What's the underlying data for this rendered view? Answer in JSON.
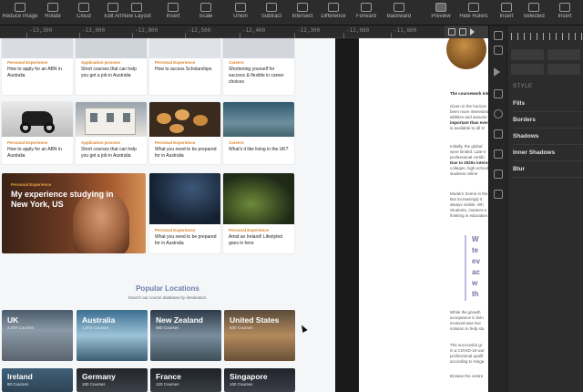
{
  "toolbar": {
    "items": [
      {
        "label": "Reduce Image",
        "icon": "image-icon"
      },
      {
        "label": "Rotate",
        "icon": "rotate-icon"
      },
      {
        "label": "Cloud",
        "icon": "cloud-icon"
      },
      {
        "label": "Edit Art",
        "icon": "pen-icon"
      },
      {
        "label": "New Layout",
        "icon": "layout-icon"
      },
      {
        "label": "Insert",
        "icon": "insert-icon"
      },
      {
        "label": "Scale",
        "icon": "scale-icon"
      },
      {
        "label": "Union",
        "icon": "union-icon"
      },
      {
        "label": "Subtract",
        "icon": "subtract-icon"
      },
      {
        "label": "Intersect",
        "icon": "intersect-icon"
      },
      {
        "label": "Difference",
        "icon": "difference-icon"
      },
      {
        "label": "Forward",
        "icon": "forward-icon"
      },
      {
        "label": "Backward",
        "icon": "backward-icon"
      },
      {
        "label": "Preview",
        "icon": "preview-icon"
      },
      {
        "label": "Hide Rulers",
        "icon": "ruler-icon"
      },
      {
        "label": "Insert",
        "icon": "insert-icon"
      },
      {
        "label": "Selected",
        "icon": "selected-icon"
      },
      {
        "label": "Insert",
        "icon": "insert-icon"
      }
    ]
  },
  "ruler": {
    "ticks": [
      "-13,300",
      "-13,000",
      "-12,800",
      "-12,500",
      "-12,400",
      "-12,300",
      "-12,080",
      "-11,800"
    ]
  },
  "cards_top": [
    {
      "category": "Personal Experience",
      "title": "How to apply for an ABN in Australia"
    },
    {
      "category": "Application process",
      "title": "Short courses that can help you get a job in Australia"
    },
    {
      "category": "Personal Experience",
      "title": "How to access Scholarships"
    },
    {
      "category": "Careers",
      "title": "Shortening yourself for success & flexible in career choices"
    }
  ],
  "cards_mid": [
    {
      "category": "Personal Experience",
      "title": "How to apply for an ABN in Australia"
    },
    {
      "category": "Application process",
      "title": "Short courses that can help you get a job in Australia"
    },
    {
      "category": "Personal Experience",
      "title": "What you need to be prepared for in Australia"
    },
    {
      "category": "Careers",
      "title": "What's it like living in the UK?"
    }
  ],
  "feature_card": {
    "category": "Personal Experience",
    "title": "My experience studying in New York, US"
  },
  "cards_low": [
    {
      "category": "Personal Experience",
      "title": "What you need to be prepared for in Australia"
    },
    {
      "category": "Personal Experience",
      "title": "Amid an Ireland! Lifestyled goes in here"
    }
  ],
  "popular": {
    "title": "Popular Locations",
    "subtitle": "Search our course database by destination.",
    "locations": [
      {
        "name": "UK",
        "count": "2,000 Courses"
      },
      {
        "name": "Australia",
        "count": "1,000 Courses"
      },
      {
        "name": "New Zealand",
        "count": "580 Courses"
      },
      {
        "name": "United States",
        "count": "600 Courses"
      },
      {
        "name": "Ireland",
        "count": "80 Courses"
      },
      {
        "name": "Germany",
        "count": "100 Courses"
      },
      {
        "name": "France",
        "count": "120 Courses"
      },
      {
        "name": "Singapore",
        "count": "100 Courses"
      }
    ]
  },
  "right_article": {
    "lines": [
      "The coursework intr",
      "Given in the horizon",
      "been more interested",
      "abilities and assume",
      "important than ever",
      "is available to all st",
      "Initially, the global",
      "were limited. Late-n",
      "professional certific",
      "Due to 2020s interna",
      "colleges, high-school",
      "students online",
      "Modern Scene in the",
      "But increasingly it",
      "always visible. Wh",
      "Students, masters-e",
      "thinking in education"
    ],
    "quote": [
      "W",
      "te",
      "ev",
      "ac",
      "w",
      "th"
    ],
    "lines_bottom": [
      "While the growth",
      "acceptance in livin",
      "involved was bec",
      "solution to help stu",
      "The successful gr",
      "in a COVID-19 wor",
      "professional qualif",
      "according to Singa",
      "Browse the centre"
    ]
  },
  "panel": {
    "style_label": "STYLE",
    "sections": [
      "Fills",
      "Borders",
      "Shadows",
      "Inner Shadows",
      "Blur"
    ]
  }
}
